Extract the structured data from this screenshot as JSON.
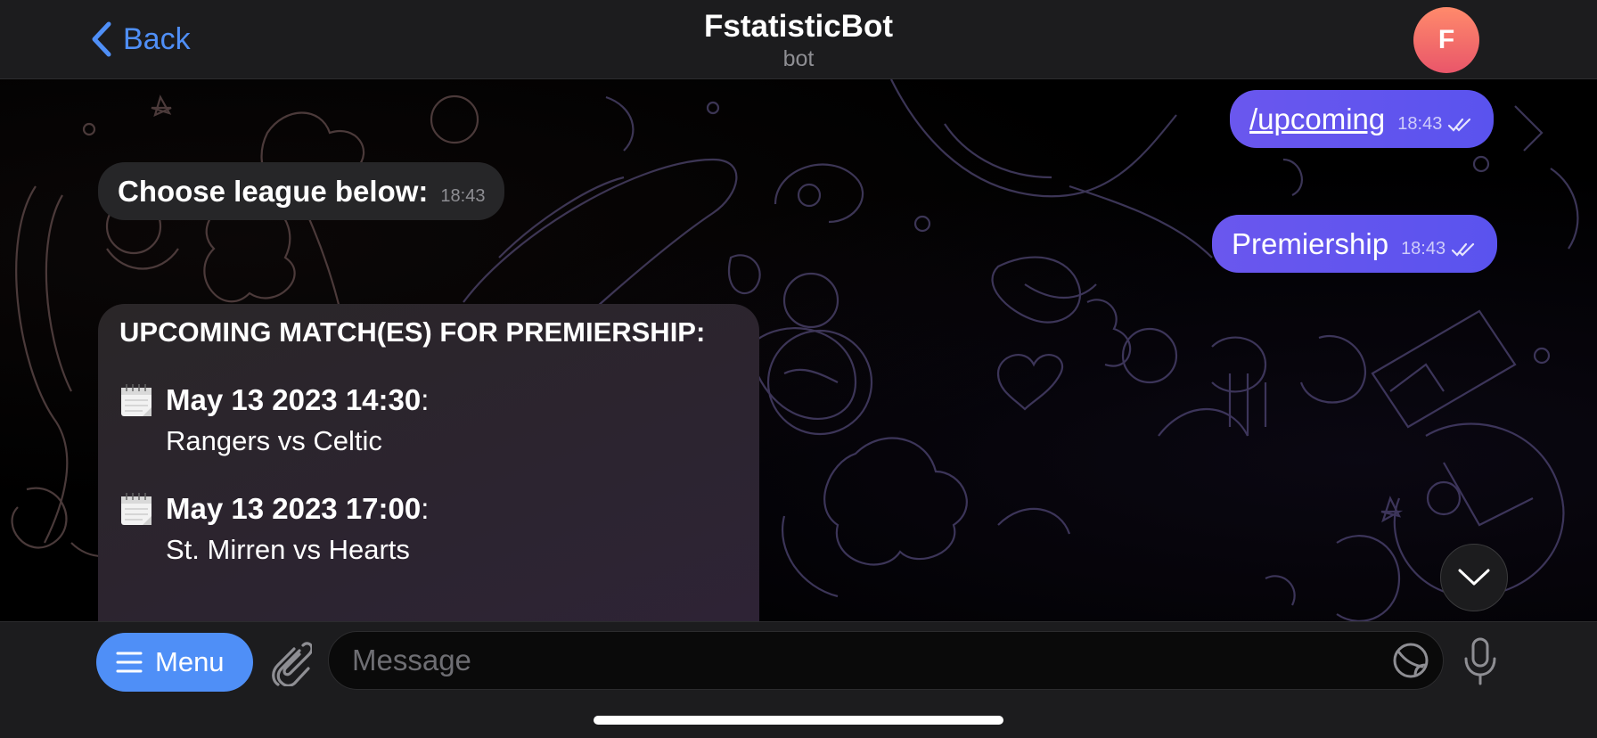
{
  "header": {
    "back_label": "Back",
    "title": "FstatisticBot",
    "subtitle": "bot",
    "avatar_letter": "F"
  },
  "messages": {
    "outgoing": [
      {
        "text": "/upcoming",
        "time": "18:43",
        "status": "read"
      },
      {
        "text": "Premiership",
        "time": "18:43",
        "status": "read"
      }
    ],
    "incoming_choose": {
      "text": "Choose league below:",
      "time": "18:43"
    },
    "incoming_upcoming": {
      "heading": "UPCOMING MATCH(ES) FOR PREMIERSHIP:",
      "matches": [
        {
          "date": "May 13 2023  14:30",
          "suffix": ":",
          "teams": "Rangers vs Celtic"
        },
        {
          "date": "May 13 2023  17:00",
          "suffix": ":",
          "teams": "St. Mirren vs Hearts"
        }
      ]
    }
  },
  "composer": {
    "menu_label": "Menu",
    "placeholder": "Message"
  },
  "colors": {
    "accent": "#4f8ff7",
    "outgoing_bubble": "#6256ee",
    "incoming_bubble": "#262628",
    "avatar": "#ef6a68"
  },
  "icons": {
    "back": "chevron-left-icon",
    "check": "double-check-icon",
    "calendar": "calendar-icon",
    "scroll": "chevron-down-icon",
    "menu": "hamburger-icon",
    "attach": "paperclip-icon",
    "sticker": "sticker-icon",
    "mic": "microphone-icon"
  }
}
